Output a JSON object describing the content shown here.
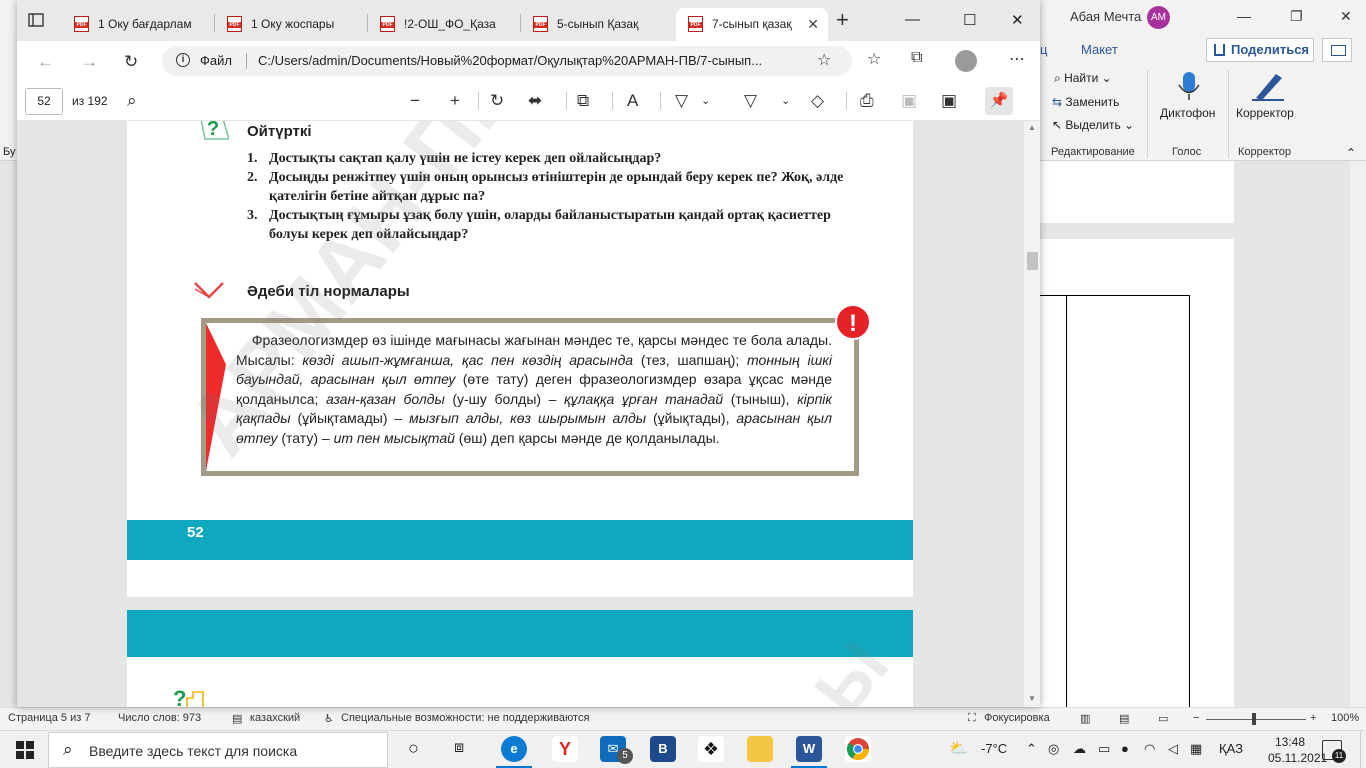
{
  "word": {
    "user_name": "Абая Мечта",
    "user_initials": "AM",
    "tabs": [
      "ц",
      "Макет"
    ],
    "share_label": "Поделиться",
    "find_label": "Найти",
    "replace_label": "Заменить",
    "select_label": "Выделить",
    "dictation_label": "Диктофон",
    "editor_label": "Корректор",
    "group_editing": "Редактирование",
    "group_voice": "Голос",
    "group_editor": "Корректор",
    "left_edge_text": "Бу",
    "status": {
      "page": "Страница 5 из 7",
      "words": "Число слов: 973",
      "language": "казахский",
      "accessibility": "Специальные возможности: не поддерживаются",
      "focus": "Фокусировка",
      "zoom": "100%"
    }
  },
  "edge": {
    "tabs": [
      {
        "label": "1 Оку бағдарлам",
        "active": false
      },
      {
        "label": "1 Оку жоспары",
        "active": false
      },
      {
        "label": "!2-ОШ_ФО_Қаза",
        "active": false
      },
      {
        "label": "5-сынып Қазақ",
        "active": false
      },
      {
        "label": "7-сынып қазақ",
        "active": true
      }
    ],
    "address": {
      "scheme_label": "Файл",
      "url": "C:/Users/admin/Documents/Новый%20формат/Оқулықтар%20АРМАН-ПВ/7-сынып..."
    },
    "pdf_toolbar": {
      "page_number": "52",
      "page_count": "из 192"
    }
  },
  "pdf": {
    "section1_title": "Ойтүрткі",
    "questions": [
      {
        "num": "1.",
        "text": "Достықты сақтап қалу үшін не істеу керек деп ойлайсыңдар?"
      },
      {
        "num": "2.",
        "text": "Досыңды ренжітпеу үшін оның орынсыз өтініштерін де орындай беру керек пе? Жоқ, әлде қателігін бетіне айтқан дұрыс па?"
      },
      {
        "num": "3.",
        "text": "Достықтың ғұмыры ұзақ болу үшін, оларды байланыстыратын қандай ортақ қасиеттер болуы керек деп ойлайсыңдар?"
      }
    ],
    "section2_title": "Әдеби тіл нормалары",
    "rule_parts": [
      {
        "t": "    Фразеологизмдер өз ішінде мағынасы жағынан мәндес те, қарсы мәндес те бола алады. Мысалы: ",
        "i": false
      },
      {
        "t": "көзді ашып-жұмғанша, қас пен көздің арасында",
        "i": true
      },
      {
        "t": " (тез, шапшаң); ",
        "i": false
      },
      {
        "t": "тонның ішкі бауындай, арасынан қыл өтпеу",
        "i": true
      },
      {
        "t": " (өте тату) деген фразеологизмдер өзара ұқсас мәнде қолданылса; ",
        "i": false
      },
      {
        "t": "азан-қазан болды",
        "i": true
      },
      {
        "t": " (у-шу болды) – ",
        "i": false
      },
      {
        "t": "құлаққа ұрған танадай",
        "i": true
      },
      {
        "t": " (тыныш), ",
        "i": false
      },
      {
        "t": "кірпік қақпады",
        "i": true
      },
      {
        "t": " (ұйықтамады) – ",
        "i": false
      },
      {
        "t": "мызғып алды, көз шырымын алды",
        "i": true
      },
      {
        "t": " (ұйықтады), ",
        "i": false
      },
      {
        "t": "арасынан қыл өтпеу",
        "i": true
      },
      {
        "t": " (тату) – ",
        "i": false
      },
      {
        "t": "ит пен мысықтай",
        "i": true
      },
      {
        "t": " (өш) деп қарсы мәнде де қолданылады.",
        "i": false
      }
    ],
    "exclamation": "!",
    "page_number": "52",
    "watermark": "АРМАН-ПВ",
    "watermark_next": "Ы"
  },
  "taskbar": {
    "search_placeholder": "Введите здесь текст для поиска",
    "mail_badge": "5",
    "temperature": "-7°C",
    "language": "ҚАЗ",
    "time": "13:48",
    "date": "05.11.2021",
    "notification_count": "11"
  },
  "colors": {
    "teal": "#10a8bf",
    "alert_red": "#e42227",
    "rule_border": "#a49a85",
    "word_blue": "#2b579a"
  }
}
